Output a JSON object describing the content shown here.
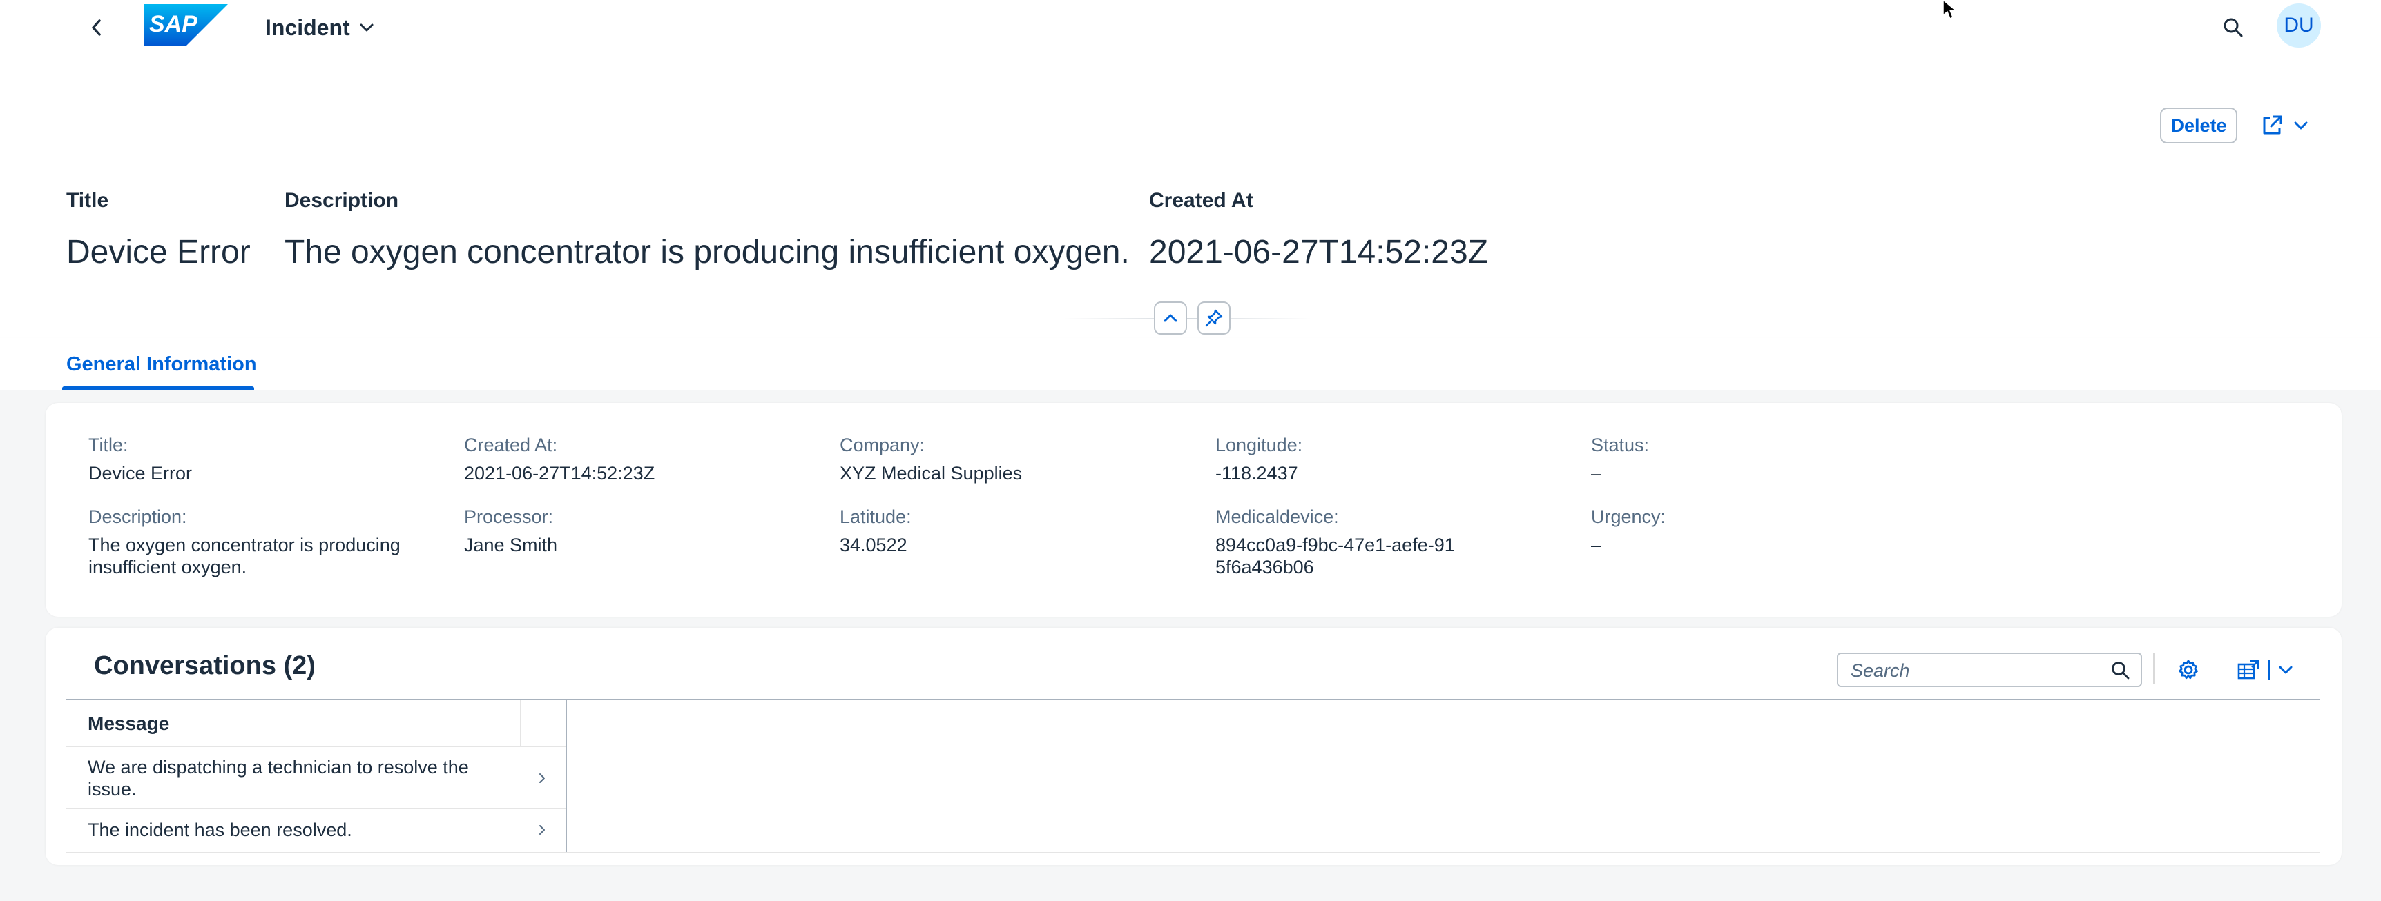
{
  "shell": {
    "app_title": "Incident",
    "logo_text": "SAP",
    "avatar_initials": "DU"
  },
  "header_actions": {
    "delete_label": "Delete"
  },
  "object_header": {
    "title_label": "Title",
    "title_value": "Device Error",
    "description_label": "Description",
    "description_value": "The oxygen concentrator is producing insufficient oxygen.",
    "created_at_label": "Created At",
    "created_at_value": "2021-06-27T14:52:23Z"
  },
  "tabs": [
    {
      "label": "General Information",
      "selected": true
    }
  ],
  "general_info": {
    "title": {
      "label": "Title:",
      "value": "Device Error"
    },
    "description": {
      "label": "Description:",
      "value": "The oxygen concentrator is producing insufficient oxygen."
    },
    "created_at": {
      "label": "Created At:",
      "value": "2021-06-27T14:52:23Z"
    },
    "processor": {
      "label": "Processor:",
      "value": "Jane Smith"
    },
    "company": {
      "label": "Company:",
      "value": "XYZ Medical Supplies"
    },
    "latitude": {
      "label": "Latitude:",
      "value": "34.0522"
    },
    "longitude": {
      "label": "Longitude:",
      "value": "-118.2437"
    },
    "medicaldevice": {
      "label": "Medicaldevice:",
      "value": "894cc0a9-f9bc-47e1-aefe-915f6a436b06"
    },
    "status": {
      "label": "Status:",
      "value": "–"
    },
    "urgency": {
      "label": "Urgency:",
      "value": "–"
    }
  },
  "conversations": {
    "title": "Conversations (2)",
    "search_placeholder": "Search",
    "column_header": "Message",
    "rows": [
      {
        "message": "We are dispatching a technician to resolve the issue."
      },
      {
        "message": "The incident has been resolved."
      }
    ]
  },
  "icons": {
    "back": "chevron-left-icon",
    "title_menu": "chevron-down-icon",
    "search": "search-icon",
    "share": "share-icon",
    "collapse": "chevron-up-icon",
    "pin": "pin-icon",
    "settings": "gear-icon",
    "export": "export-spreadsheet-icon",
    "row_nav": "chevron-right-icon"
  },
  "colors": {
    "accent": "#0064d9",
    "text": "#1d2d3e",
    "label": "#556b82",
    "background": "#f5f6f7",
    "avatar_bg": "#d1efff"
  }
}
